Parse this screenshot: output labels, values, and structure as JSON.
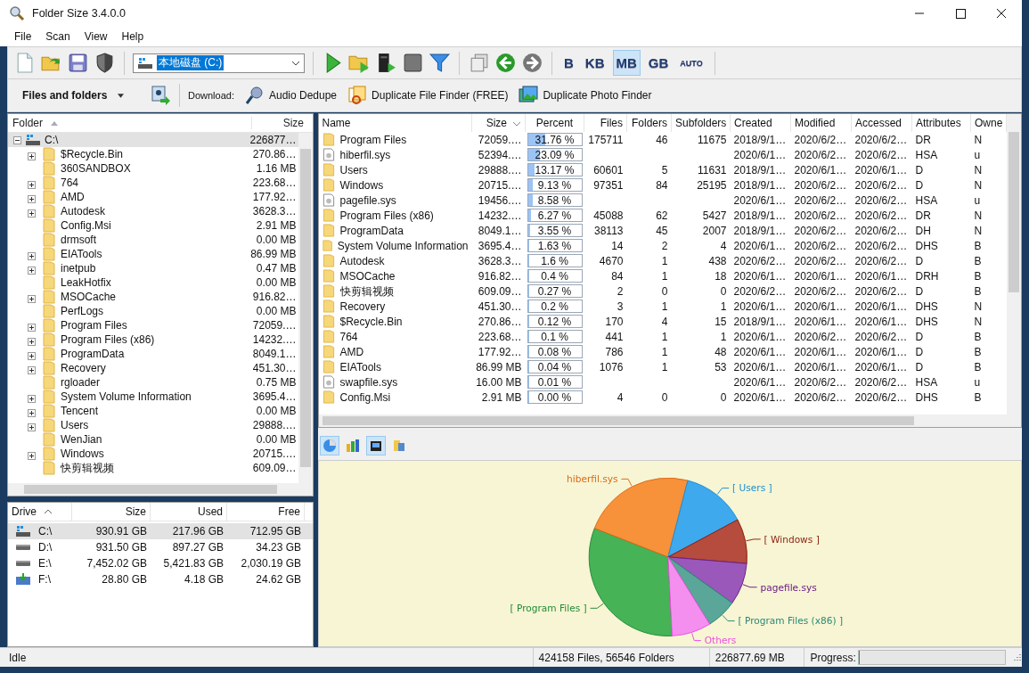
{
  "window": {
    "title": "Folder Size 3.4.0.0"
  },
  "menu": [
    "File",
    "Scan",
    "View",
    "Help"
  ],
  "toolbar": {
    "drive_combo": "本地磁盘 (C:)",
    "units": [
      {
        "label": "B",
        "selected": false
      },
      {
        "label": "KB",
        "selected": false
      },
      {
        "label": "MB",
        "selected": true
      },
      {
        "label": "GB",
        "selected": false
      },
      {
        "label": "AUTO",
        "selected": false
      }
    ]
  },
  "toolbar2": {
    "view_dropdown": "Files and folders",
    "download_label": "Download:",
    "downloads": [
      {
        "kind": "audio",
        "label": "Audio Dedupe"
      },
      {
        "kind": "duplicate",
        "label": "Duplicate File Finder (FREE)"
      },
      {
        "kind": "photo",
        "label": "Duplicate Photo Finder"
      }
    ]
  },
  "tree": {
    "columns": [
      {
        "label": "Folder",
        "sorted": true
      },
      {
        "label": "Size",
        "sorted": false
      }
    ],
    "sort_descending": false,
    "root": {
      "name": "C:\\",
      "size": "226877…",
      "expanded": true,
      "selected": true,
      "children": [
        {
          "name": "$Recycle.Bin",
          "size": "270.86…",
          "expandable": true,
          "selected": false
        },
        {
          "name": "360SANDBOX",
          "size": "1.16 MB",
          "expandable": false,
          "selected": false
        },
        {
          "name": "764",
          "size": "223.68…",
          "expandable": true,
          "selected": false
        },
        {
          "name": "AMD",
          "size": "177.92…",
          "expandable": true,
          "selected": false
        },
        {
          "name": "Autodesk",
          "size": "3628.3…",
          "expandable": true,
          "selected": false
        },
        {
          "name": "Config.Msi",
          "size": "2.91 MB",
          "expandable": false,
          "selected": false
        },
        {
          "name": "drmsoft",
          "size": "0.00 MB",
          "expandable": false,
          "selected": false
        },
        {
          "name": "EIATools",
          "size": "86.99 MB",
          "expandable": true,
          "selected": false
        },
        {
          "name": "inetpub",
          "size": "0.47 MB",
          "expandable": true,
          "selected": false
        },
        {
          "name": "LeakHotfix",
          "size": "0.00 MB",
          "expandable": false,
          "selected": false
        },
        {
          "name": "MSOCache",
          "size": "916.82…",
          "expandable": true,
          "selected": false
        },
        {
          "name": "PerfLogs",
          "size": "0.00 MB",
          "expandable": false,
          "selected": false
        },
        {
          "name": "Program Files",
          "size": "72059.…",
          "expandable": true,
          "selected": false
        },
        {
          "name": "Program Files (x86)",
          "size": "14232.…",
          "expandable": true,
          "selected": false
        },
        {
          "name": "ProgramData",
          "size": "8049.1…",
          "expandable": true,
          "selected": false
        },
        {
          "name": "Recovery",
          "size": "451.30…",
          "expandable": true,
          "selected": false
        },
        {
          "name": "rgloader",
          "size": "0.75 MB",
          "expandable": false,
          "selected": false
        },
        {
          "name": "System Volume Information",
          "size": "3695.4…",
          "expandable": true,
          "selected": false
        },
        {
          "name": "Tencent",
          "size": "0.00 MB",
          "expandable": true,
          "selected": false
        },
        {
          "name": "Users",
          "size": "29888.…",
          "expandable": true,
          "selected": false
        },
        {
          "name": "WenJian",
          "size": "0.00 MB",
          "expandable": false,
          "selected": false
        },
        {
          "name": "Windows",
          "size": "20715.…",
          "expandable": true,
          "selected": false
        },
        {
          "name": "快剪辑视频",
          "size": "609.09…",
          "expandable": false,
          "selected": false
        }
      ]
    }
  },
  "file_list": {
    "sort_descending": true,
    "columns": [
      {
        "label": "Name",
        "sorted": false
      },
      {
        "label": "Size",
        "sorted": true
      },
      {
        "label": "Percent",
        "sorted": false
      },
      {
        "label": "Files",
        "sorted": false
      },
      {
        "label": "Folders",
        "sorted": false
      },
      {
        "label": "Subfolders",
        "sorted": false
      },
      {
        "label": "Created",
        "sorted": false
      },
      {
        "label": "Modified",
        "sorted": false
      },
      {
        "label": "Accessed",
        "sorted": false
      },
      {
        "label": "Attributes",
        "sorted": false
      },
      {
        "label": "Owne",
        "sorted": false
      }
    ],
    "rows": [
      {
        "kind": "folder",
        "name": "Program Files",
        "size": "72059.…",
        "percent": "31.76 %",
        "level": 0.3176,
        "files": "175711",
        "folders": "46",
        "subfolders": "11675",
        "created": "2018/9/1…",
        "modified": "2020/6/2…",
        "accessed": "2020/6/2…",
        "attributes": "DR",
        "owner": "N"
      },
      {
        "kind": "file",
        "name": "hiberfil.sys",
        "size": "52394.…",
        "percent": "23.09 %",
        "level": 0.2309,
        "created": "2020/6/1…",
        "modified": "2020/6/2…",
        "accessed": "2020/6/2…",
        "attributes": "HSA",
        "owner": "u"
      },
      {
        "kind": "folder",
        "name": "Users",
        "size": "29888.…",
        "percent": "13.17 %",
        "level": 0.1317,
        "files": "60601",
        "folders": "5",
        "subfolders": "11631",
        "created": "2018/9/1…",
        "modified": "2020/6/1…",
        "accessed": "2020/6/1…",
        "attributes": "D",
        "owner": "N"
      },
      {
        "kind": "folder",
        "name": "Windows",
        "size": "20715.…",
        "percent": "9.13 %",
        "level": 0.0913,
        "files": "97351",
        "folders": "84",
        "subfolders": "25195",
        "created": "2018/9/1…",
        "modified": "2020/6/2…",
        "accessed": "2020/6/2…",
        "attributes": "D",
        "owner": "N"
      },
      {
        "kind": "file",
        "name": "pagefile.sys",
        "size": "19456.…",
        "percent": "8.58 %",
        "level": 0.0858,
        "created": "2020/6/1…",
        "modified": "2020/6/2…",
        "accessed": "2020/6/2…",
        "attributes": "HSA",
        "owner": "u"
      },
      {
        "kind": "folder",
        "name": "Program Files (x86)",
        "size": "14232.…",
        "percent": "6.27 %",
        "level": 0.0627,
        "files": "45088",
        "folders": "62",
        "subfolders": "5427",
        "created": "2018/9/1…",
        "modified": "2020/6/2…",
        "accessed": "2020/6/2…",
        "attributes": "DR",
        "owner": "N"
      },
      {
        "kind": "folder",
        "name": "ProgramData",
        "size": "8049.1…",
        "percent": "3.55 %",
        "level": 0.0355,
        "files": "38113",
        "folders": "45",
        "subfolders": "2007",
        "created": "2018/9/1…",
        "modified": "2020/6/2…",
        "accessed": "2020/6/2…",
        "attributes": "DH",
        "owner": "N"
      },
      {
        "kind": "folder",
        "name": "System Volume Information",
        "size": "3695.4…",
        "percent": "1.63 %",
        "level": 0.0163,
        "files": "14",
        "folders": "2",
        "subfolders": "4",
        "created": "2020/6/1…",
        "modified": "2020/6/2…",
        "accessed": "2020/6/2…",
        "attributes": "DHS",
        "owner": "B"
      },
      {
        "kind": "folder",
        "name": "Autodesk",
        "size": "3628.3…",
        "percent": "1.6 %",
        "level": 0.016,
        "files": "4670",
        "folders": "1",
        "subfolders": "438",
        "created": "2020/6/2…",
        "modified": "2020/6/2…",
        "accessed": "2020/6/2…",
        "attributes": "D",
        "owner": "B"
      },
      {
        "kind": "folder",
        "name": "MSOCache",
        "size": "916.82…",
        "percent": "0.4 %",
        "level": 0.004,
        "files": "84",
        "folders": "1",
        "subfolders": "18",
        "created": "2020/6/1…",
        "modified": "2020/6/1…",
        "accessed": "2020/6/1…",
        "attributes": "DRH",
        "owner": "B"
      },
      {
        "kind": "folder",
        "name": "快剪辑视频",
        "size": "609.09…",
        "percent": "0.27 %",
        "level": 0.0027,
        "files": "2",
        "folders": "0",
        "subfolders": "0",
        "created": "2020/6/2…",
        "modified": "2020/6/2…",
        "accessed": "2020/6/2…",
        "attributes": "D",
        "owner": "B"
      },
      {
        "kind": "folder",
        "name": "Recovery",
        "size": "451.30…",
        "percent": "0.2 %",
        "level": 0.002,
        "files": "3",
        "folders": "1",
        "subfolders": "1",
        "created": "2020/6/1…",
        "modified": "2020/6/1…",
        "accessed": "2020/6/1…",
        "attributes": "DHS",
        "owner": "N"
      },
      {
        "kind": "folder",
        "name": "$Recycle.Bin",
        "size": "270.86…",
        "percent": "0.12 %",
        "level": 0.0012,
        "files": "170",
        "folders": "4",
        "subfolders": "15",
        "created": "2018/9/1…",
        "modified": "2020/6/1…",
        "accessed": "2020/6/1…",
        "attributes": "DHS",
        "owner": "N"
      },
      {
        "kind": "folder",
        "name": "764",
        "size": "223.68…",
        "percent": "0.1 %",
        "level": 0.001,
        "files": "441",
        "folders": "1",
        "subfolders": "1",
        "created": "2020/6/1…",
        "modified": "2020/6/2…",
        "accessed": "2020/6/2…",
        "attributes": "D",
        "owner": "B"
      },
      {
        "kind": "folder",
        "name": "AMD",
        "size": "177.92…",
        "percent": "0.08 %",
        "level": 0.0008,
        "files": "786",
        "folders": "1",
        "subfolders": "48",
        "created": "2020/6/1…",
        "modified": "2020/6/1…",
        "accessed": "2020/6/1…",
        "attributes": "D",
        "owner": "B"
      },
      {
        "kind": "folder",
        "name": "EIATools",
        "size": "86.99 MB",
        "percent": "0.04 %",
        "level": 0.0004,
        "files": "1076",
        "folders": "1",
        "subfolders": "53",
        "created": "2020/6/1…",
        "modified": "2020/6/1…",
        "accessed": "2020/6/1…",
        "attributes": "D",
        "owner": "B"
      },
      {
        "kind": "file",
        "name": "swapfile.sys",
        "size": "16.00 MB",
        "percent": "0.01 %",
        "level": 0.0001,
        "created": "2020/6/1…",
        "modified": "2020/6/2…",
        "accessed": "2020/6/2…",
        "attributes": "HSA",
        "owner": "u"
      },
      {
        "kind": "folder",
        "name": "Config.Msi",
        "size": "2.91 MB",
        "percent": "0.00 %",
        "level": 0,
        "files": "4",
        "folders": "0",
        "subfolders": "0",
        "created": "2020/6/1…",
        "modified": "2020/6/2…",
        "accessed": "2020/6/2…",
        "attributes": "DHS",
        "owner": "B"
      }
    ]
  },
  "chart_view_buttons": [
    {
      "kind": "pie",
      "selected": true
    },
    {
      "kind": "bar",
      "selected": false
    },
    {
      "kind": "film",
      "selected": true
    },
    {
      "kind": "folders",
      "selected": false
    }
  ],
  "chart": {
    "chart_data": {
      "type": "pie",
      "categories": [
        "[ Program Files ]",
        "hiberfil.sys",
        "[ Users ]",
        "[ Windows ]",
        "pagefile.sys",
        "[ Program Files (x86) ]",
        "Others"
      ],
      "values": [
        31.76,
        23.09,
        13.17,
        9.13,
        8.58,
        6.27,
        8.0
      ]
    }
  },
  "drives": {
    "sort_descending": false,
    "columns": [
      {
        "label": "Drive",
        "sorted": true
      },
      {
        "label": "Size",
        "sorted": false
      },
      {
        "label": "Used",
        "sorted": false
      },
      {
        "label": "Free",
        "sorted": false
      }
    ],
    "rows": [
      {
        "kind": "system",
        "drive": "C:\\",
        "size": "930.91 GB",
        "used": "217.96 GB",
        "free": "712.95 GB",
        "selected": true
      },
      {
        "kind": "disk",
        "drive": "D:\\",
        "size": "931.50 GB",
        "used": "897.27 GB",
        "free": "34.23 GB",
        "selected": false
      },
      {
        "kind": "disk",
        "drive": "E:\\",
        "size": "7,452.02 GB",
        "used": "5,421.83 GB",
        "free": "2,030.19 GB",
        "selected": false
      },
      {
        "kind": "usb",
        "drive": "F:\\",
        "size": "28.80 GB",
        "used": "4.18 GB",
        "free": "24.62 GB",
        "selected": false
      }
    ]
  },
  "status_bar": {
    "state": "Idle",
    "counts": "424158 Files, 56546 Folders",
    "total": "226877.69 MB",
    "progress_label": "Progress:",
    "progress": {
      "level": 0
    }
  }
}
